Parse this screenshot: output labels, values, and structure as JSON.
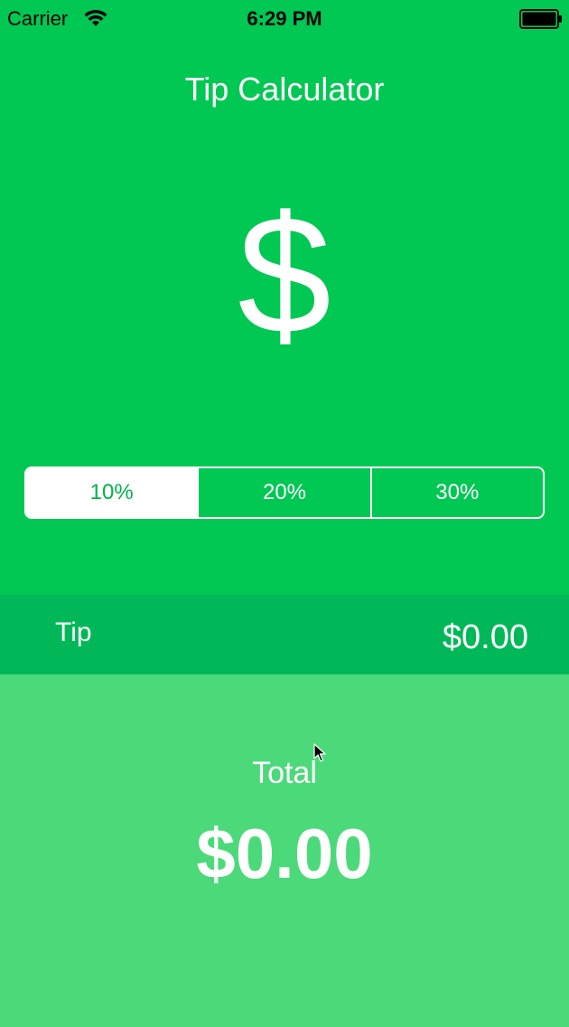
{
  "status_bar": {
    "carrier": "Carrier",
    "time": "6:29 PM",
    "wifi_icon": "wifi-icon",
    "battery_icon": "battery-icon"
  },
  "header": {
    "title": "Tip Calculator"
  },
  "bill": {
    "placeholder": "$"
  },
  "tip_options": {
    "selected_index": 0,
    "segments": [
      "10%",
      "20%",
      "30%"
    ]
  },
  "tip": {
    "label": "Tip",
    "value": "$0.00"
  },
  "total": {
    "label": "Total",
    "value": "$0.00"
  },
  "colors": {
    "background": "#00c853",
    "tip_row": "#00b858",
    "total_area": "#4cd97a",
    "text": "#ffffff"
  }
}
